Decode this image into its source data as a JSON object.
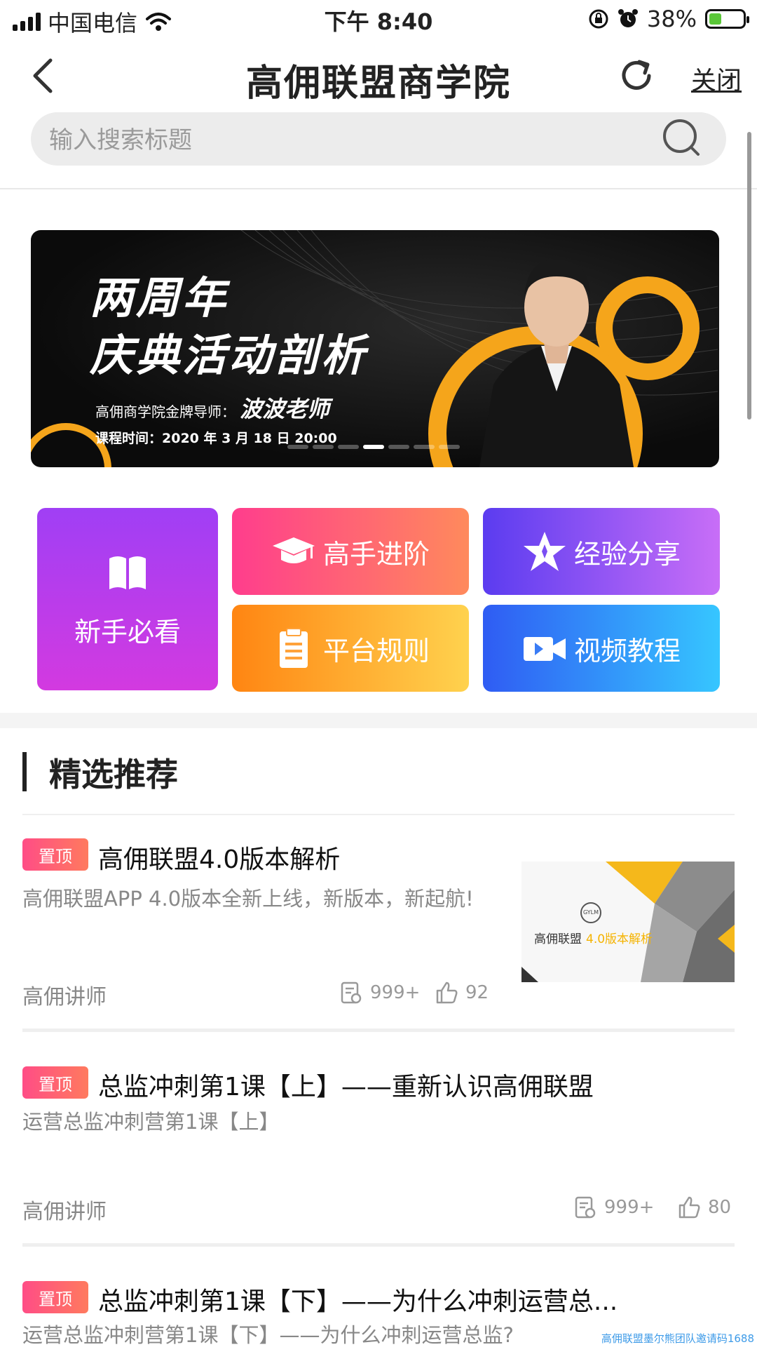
{
  "status_bar": {
    "carrier": "中国电信",
    "time": "下午 8:40",
    "battery": "38%",
    "battery_level": 0.38
  },
  "nav": {
    "title": "高佣联盟商学院",
    "close_label": "关闭"
  },
  "search": {
    "placeholder": "输入搜索标题"
  },
  "banner": {
    "headline_1": "两周年",
    "headline_2": "庆典活动剖析",
    "teacher_prefix": "高佣商学院金牌导师：",
    "teacher_name": "波波老师",
    "course_time": "课程时间：2020 年 3 月 18 日 20:00",
    "slide_count": 7,
    "active_slide": 4
  },
  "categories": {
    "newbie": "新手必看",
    "advanced": "高手进阶",
    "experience": "经验分享",
    "rules": "平台规则",
    "video": "视频教程"
  },
  "section": {
    "title": "精选推荐"
  },
  "articles": [
    {
      "tag": "置顶",
      "title": "高佣联盟4.0版本解析",
      "desc": "高佣联盟APP 4.0版本全新上线，新版本，新起航!",
      "author": "高佣讲师",
      "views": "999+",
      "likes": "92",
      "thumb_brand": "高佣联盟",
      "thumb_caption": "4.0版本解析",
      "thumb_logo": "GYLM"
    },
    {
      "tag": "置顶",
      "title": "总监冲刺第1课【上】——重新认识高佣联盟",
      "desc": "运营总监冲刺营第1课【上】",
      "author": "高佣讲师",
      "views": "999+",
      "likes": "80"
    },
    {
      "tag": "置顶",
      "title": "总监冲刺第1课【下】——为什么冲刺运营总...",
      "desc": "运营总监冲刺营第1课【下】——为什么冲刺运营总监?"
    }
  ],
  "watermark": "高佣联盟墨尔熊团队邀请码1688",
  "colors": {
    "accent_pink": "#ff4d86",
    "text_gray": "#888888"
  }
}
